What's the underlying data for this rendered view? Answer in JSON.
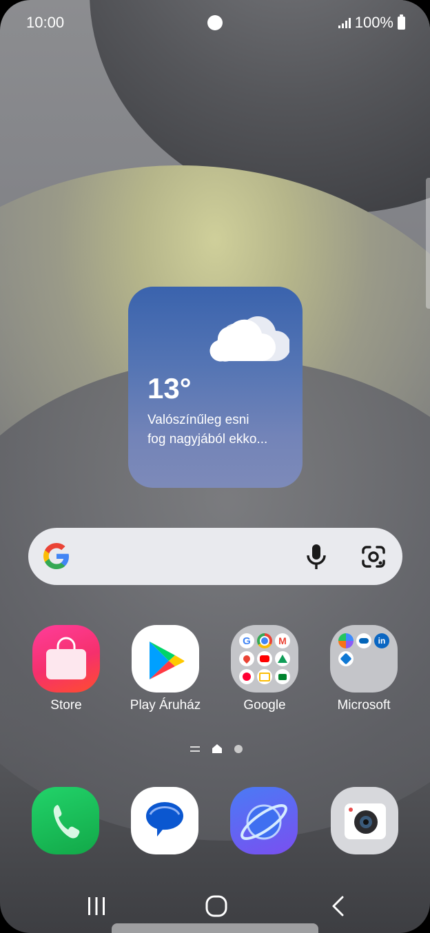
{
  "status": {
    "time": "10:00",
    "battery": "100%"
  },
  "weather": {
    "temperature": "13°",
    "description_line1": "Valószínűleg esni",
    "description_line2": "fog nagyjából ekko...",
    "icon": "cloud-icon"
  },
  "search": {
    "icons": [
      "google-icon",
      "mic-icon",
      "lens-icon"
    ]
  },
  "apps": [
    {
      "label": "Store",
      "icon": "store-icon"
    },
    {
      "label": "Play Áruház",
      "icon": "play-store-icon"
    },
    {
      "label": "Google",
      "icon": "folder-icon"
    },
    {
      "label": "Microsoft",
      "icon": "folder-icon"
    }
  ],
  "dock": [
    {
      "icon": "phone-icon"
    },
    {
      "icon": "messages-icon"
    },
    {
      "icon": "internet-icon"
    },
    {
      "icon": "camera-icon"
    }
  ],
  "navigation": {
    "icons": [
      "recents-icon",
      "home-icon",
      "back-icon"
    ]
  },
  "colors": {
    "accent": "#3a63ad",
    "phone": "#1fb85a",
    "store": "#f5306c"
  }
}
